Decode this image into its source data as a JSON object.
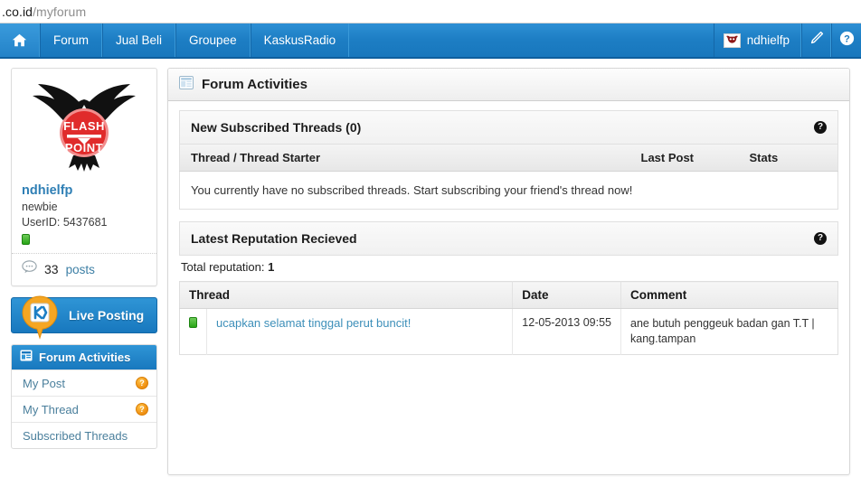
{
  "browser": {
    "url_domain": ".co.id",
    "url_path": "/myforum"
  },
  "topnav": {
    "home_icon": "home-icon",
    "items": [
      {
        "label": "Forum"
      },
      {
        "label": "Jual Beli"
      },
      {
        "label": "Groupee"
      },
      {
        "label": "KaskusRadio"
      }
    ],
    "username": "ndhielfp",
    "avatar_icon": "avatar-bull-icon",
    "edit_icon": "pencil-icon",
    "help_icon": "help-circle-icon"
  },
  "sidebar": {
    "avatar_icon": "eagle-flashpoint-avatar",
    "avatar_text_top": "FLASH",
    "avatar_text_bottom": "POINT",
    "username": "ndhielfp",
    "rank": "newbie",
    "userid": "UserID: 5437681",
    "status_icon": "online-status-icon",
    "posts_icon": "speech-bubble-icon",
    "posts_count": "33",
    "posts_label": "posts",
    "live_posting": {
      "label": "Live Posting",
      "icon": "kaskus-pin-icon"
    },
    "nav_card": {
      "header_label": "Forum Activities",
      "header_icon": "forum-activities-icon",
      "items": [
        {
          "label": "My Post",
          "badge": "?"
        },
        {
          "label": "My Thread",
          "badge": "?"
        },
        {
          "label": "Subscribed Threads",
          "badge": ""
        }
      ]
    }
  },
  "main": {
    "header_title": "Forum Activities",
    "header_icon": "panel-list-icon",
    "subscribed_panel": {
      "title": "New Subscribed Threads (0)",
      "help_icon": "?",
      "columns": [
        "Thread / Thread Starter",
        "Last Post",
        "Stats"
      ],
      "empty_message": "You currently have no subscribed threads. Start subscribing your friend's thread now!"
    },
    "reputation_panel": {
      "title": "Latest Reputation Recieved",
      "help_icon": "?",
      "total_label": "Total reputation:",
      "total_value": "1",
      "columns": [
        "Thread",
        "Date",
        "Comment"
      ],
      "rows": [
        {
          "icon": "green-thread-icon",
          "thread": "ucapkan selamat tinggal perut buncit!",
          "date": "12-05-2013 09:55",
          "comment": "ane butuh penggeuk badan gan T.T | kang.tampan"
        }
      ]
    }
  },
  "colors": {
    "nav_blue": "#1d7ec4",
    "link_blue": "#3d8fb9",
    "accent_orange": "#ef8f11",
    "status_green": "#28a516"
  }
}
